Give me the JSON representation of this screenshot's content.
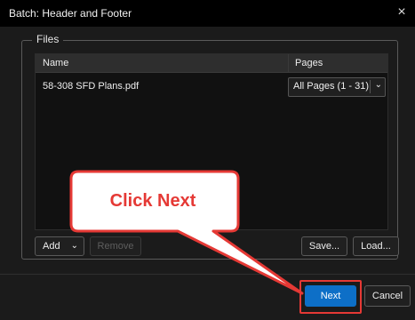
{
  "window": {
    "title": "Batch: Header and Footer",
    "close_icon": "×"
  },
  "files": {
    "legend": "Files",
    "columns": {
      "name": "Name",
      "pages": "Pages"
    },
    "rows": [
      {
        "name": "58-308 SFD Plans.pdf",
        "pages": "All Pages (1 - 31)"
      }
    ]
  },
  "buttons": {
    "add": "Add",
    "remove": "Remove",
    "save": "Save...",
    "load": "Load...",
    "next": "Next",
    "cancel": "Cancel"
  },
  "callout": {
    "text": "Click Next",
    "color": "#e53935"
  },
  "colors": {
    "accent": "#0d6fc7",
    "highlight": "#e53935"
  }
}
